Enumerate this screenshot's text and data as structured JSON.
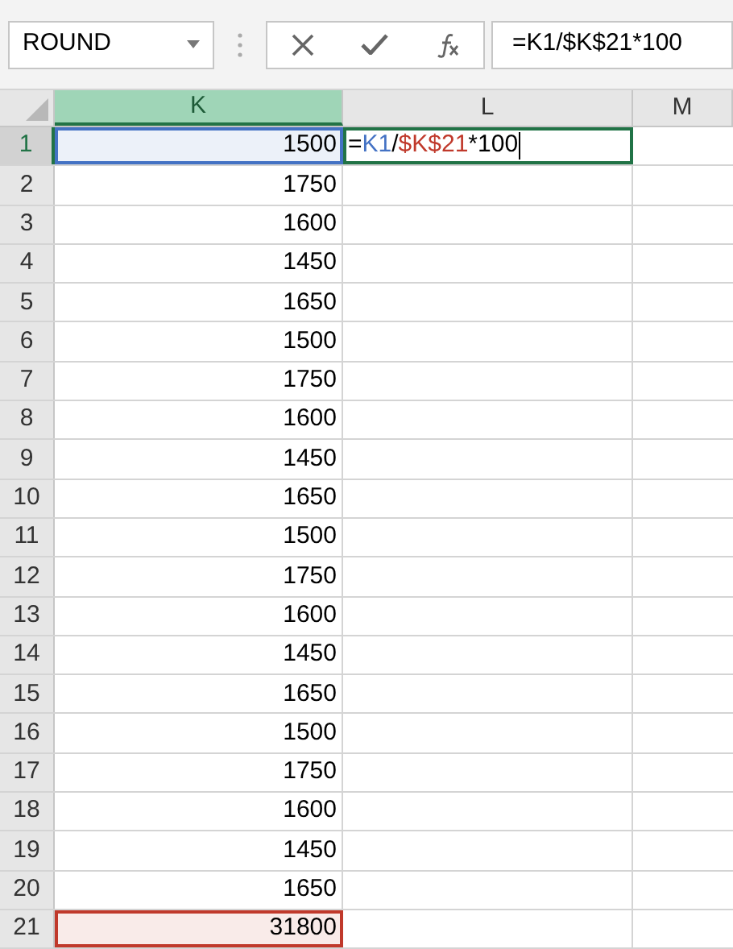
{
  "name_box": {
    "value": "ROUND"
  },
  "formula_bar": {
    "value": "=K1/$K$21*100"
  },
  "columns": [
    {
      "label": "K",
      "selected": true
    },
    {
      "label": "L",
      "selected": false
    },
    {
      "label": "M",
      "selected": false
    }
  ],
  "rows": [
    {
      "header": "1",
      "selected": true,
      "k": {
        "value": "1500",
        "color": "#4472c4"
      },
      "l": {
        "parts": [
          {
            "text": "=",
            "color": "#000000"
          },
          {
            "text": "K1",
            "color": "#4472c4"
          },
          {
            "text": "/",
            "color": "#000000"
          },
          {
            "text": "$K$21",
            "color": "#c0392b"
          },
          {
            "text": "*100",
            "color": "#000000"
          }
        ]
      }
    },
    {
      "header": "2",
      "selected": false,
      "k": {
        "value": "1750"
      }
    },
    {
      "header": "3",
      "selected": false,
      "k": {
        "value": "1600"
      }
    },
    {
      "header": "4",
      "selected": false,
      "k": {
        "value": "1450"
      }
    },
    {
      "header": "5",
      "selected": false,
      "k": {
        "value": "1650"
      }
    },
    {
      "header": "6",
      "selected": false,
      "k": {
        "value": "1500"
      }
    },
    {
      "header": "7",
      "selected": false,
      "k": {
        "value": "1750"
      }
    },
    {
      "header": "8",
      "selected": false,
      "k": {
        "value": "1600"
      }
    },
    {
      "header": "9",
      "selected": false,
      "k": {
        "value": "1450"
      }
    },
    {
      "header": "10",
      "selected": false,
      "k": {
        "value": "1650"
      }
    },
    {
      "header": "11",
      "selected": false,
      "k": {
        "value": "1500"
      }
    },
    {
      "header": "12",
      "selected": false,
      "k": {
        "value": "1750"
      }
    },
    {
      "header": "13",
      "selected": false,
      "k": {
        "value": "1600"
      }
    },
    {
      "header": "14",
      "selected": false,
      "k": {
        "value": "1450"
      }
    },
    {
      "header": "15",
      "selected": false,
      "k": {
        "value": "1650"
      }
    },
    {
      "header": "16",
      "selected": false,
      "k": {
        "value": "1500"
      }
    },
    {
      "header": "17",
      "selected": false,
      "k": {
        "value": "1750"
      }
    },
    {
      "header": "18",
      "selected": false,
      "k": {
        "value": "1600"
      }
    },
    {
      "header": "19",
      "selected": false,
      "k": {
        "value": "1450"
      }
    },
    {
      "header": "20",
      "selected": false,
      "k": {
        "value": "1650"
      }
    },
    {
      "header": "21",
      "selected": false,
      "k": {
        "value": "31800",
        "color": "#c0392b"
      }
    }
  ]
}
